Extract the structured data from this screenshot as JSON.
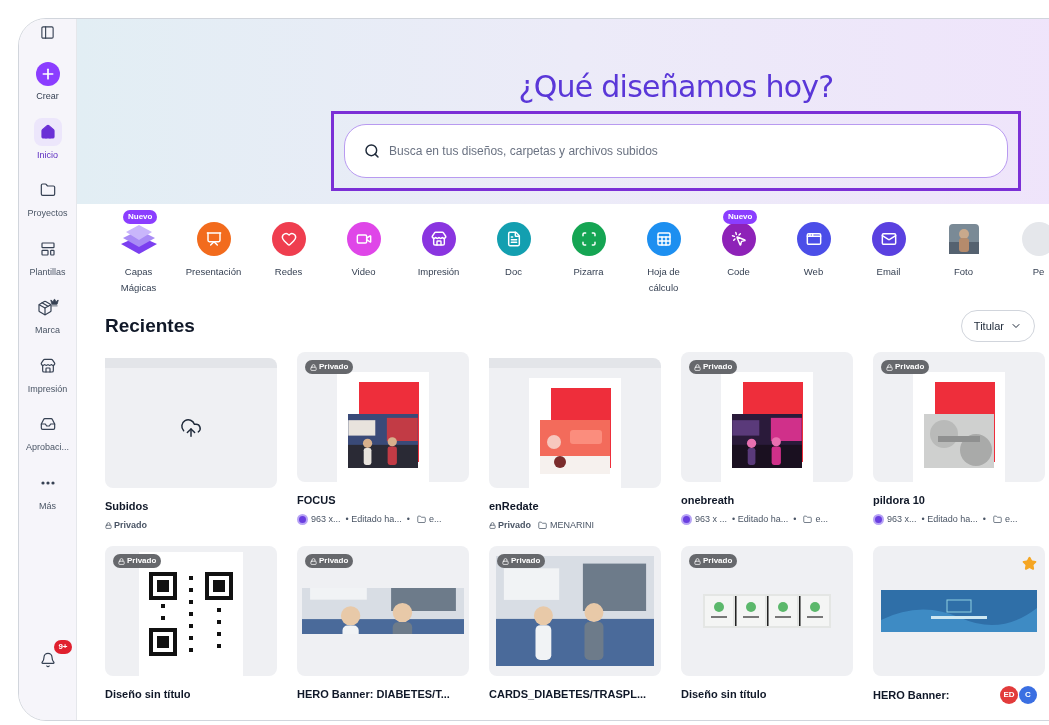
{
  "sidebar": {
    "items": [
      {
        "kind": "create",
        "label": "Crear",
        "selected": false
      },
      {
        "kind": "home",
        "label": "Inicio",
        "selected": true
      },
      {
        "kind": "folder",
        "label": "Proyectos",
        "selected": false
      },
      {
        "kind": "template",
        "label": "Plantillas",
        "selected": false
      },
      {
        "kind": "brand",
        "label": "Marca",
        "selected": false
      },
      {
        "kind": "print",
        "label": "Impresión",
        "selected": false
      },
      {
        "kind": "inbox",
        "label": "Aprobaci...",
        "selected": false
      },
      {
        "kind": "more",
        "label": "Más",
        "selected": false
      }
    ],
    "notifications": {
      "badge": "9+"
    }
  },
  "hero": {
    "title": "¿Qué diseñamos hoy?",
    "search": {
      "placeholder": "Busca en tus diseños, carpetas y archivos subidos"
    }
  },
  "categories": [
    {
      "kind": "layers",
      "label": "Capas Mágicas",
      "badge": "Nuevo"
    },
    {
      "kind": "presentation",
      "label": "Presentación",
      "color": "#f26b1d"
    },
    {
      "kind": "social",
      "label": "Redes",
      "color": "#ef3e4f"
    },
    {
      "kind": "video",
      "label": "Video",
      "color": "#df46e8"
    },
    {
      "kind": "print",
      "label": "Impresión",
      "color": "#8a35e0"
    },
    {
      "kind": "doc",
      "label": "Doc",
      "color": "#139fb0"
    },
    {
      "kind": "whiteboard",
      "label": "Pizarra",
      "color": "#15a553"
    },
    {
      "kind": "sheet",
      "label": "Hoja de cálculo",
      "color": "#1d8ff0"
    },
    {
      "kind": "code",
      "label": "Code",
      "color": "#8e22b8",
      "badge": "Nuevo"
    },
    {
      "kind": "web",
      "label": "Web",
      "color": "#4b4ee8"
    },
    {
      "kind": "email",
      "label": "Email",
      "color": "#5a41e0"
    },
    {
      "label": "Foto"
    },
    {
      "kind": "more",
      "label": "Pe",
      "color": "#e5e7eb"
    }
  ],
  "recent": {
    "title": "Recientes",
    "sort": "Titular",
    "items": [
      {
        "kind": "folder-upload",
        "title": "Subidos",
        "meta": {
          "privacy": "Privado"
        }
      },
      {
        "kind": "doc-photo",
        "badge": "Privado",
        "title": "FOCUS",
        "meta": {
          "size": "963 x...",
          "edited": "• Editado ha...",
          "folder": "• ",
          "folder_name": "e..."
        }
      },
      {
        "kind": "folder-doc",
        "title": "enRedate",
        "meta": {
          "privacy": "Privado",
          "folder_name": "MENARINI"
        }
      },
      {
        "kind": "doc-photo",
        "badge": "Privado",
        "title": "onebreath",
        "meta": {
          "size": "963 x ...",
          "edited": "• Editado ha...",
          "folder": "• ",
          "folder_name": "e..."
        }
      },
      {
        "kind": "doc-gray",
        "badge": "Privado",
        "title": "pildora 10",
        "meta": {
          "size": "963 x...",
          "edited": "• Editado ha...",
          "folder": "• ",
          "folder_name": "e..."
        }
      },
      {
        "kind": "qr",
        "badge": "Privado",
        "title": "Diseño sin título"
      },
      {
        "kind": "banner-photo",
        "badge": "Privado",
        "title": "HERO Banner: DIABETES/T..."
      },
      {
        "badge": "Privado",
        "title": "CARDS_DIABETES/TRASPL..."
      },
      {
        "kind": "icon-strip",
        "badge": "Privado",
        "title": "Diseño sin título"
      },
      {
        "kind": "banner-blue",
        "title": "HERO Banner:",
        "starred": true,
        "collaborators": [
          {
            "label": "ED",
            "color": "#e23b3b"
          },
          {
            "label": "C",
            "color": "#3b6fe2"
          }
        ]
      }
    ]
  }
}
